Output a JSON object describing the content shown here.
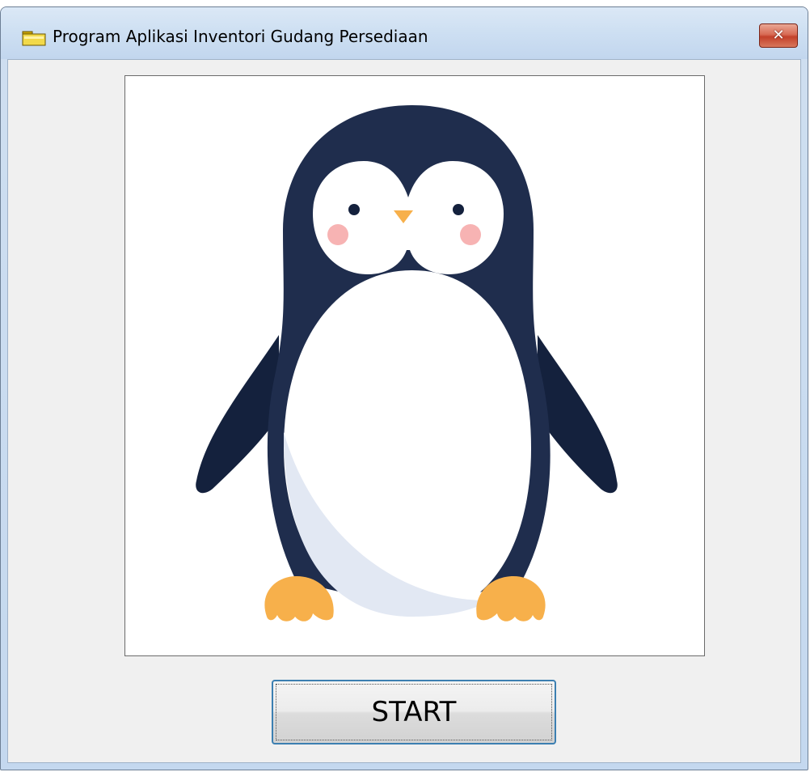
{
  "window": {
    "title": "Program Aplikasi Inventori Gudang Persediaan",
    "close_glyph": "✕",
    "icon": "folder-icon"
  },
  "main": {
    "image": "penguin-illustration",
    "start_label": "START"
  },
  "colors": {
    "penguin_body": "#1f2d4d",
    "penguin_belly_shade": "#e2e8f3",
    "beak_feet": "#f7b04b",
    "cheeks": "#f7b3b3"
  }
}
